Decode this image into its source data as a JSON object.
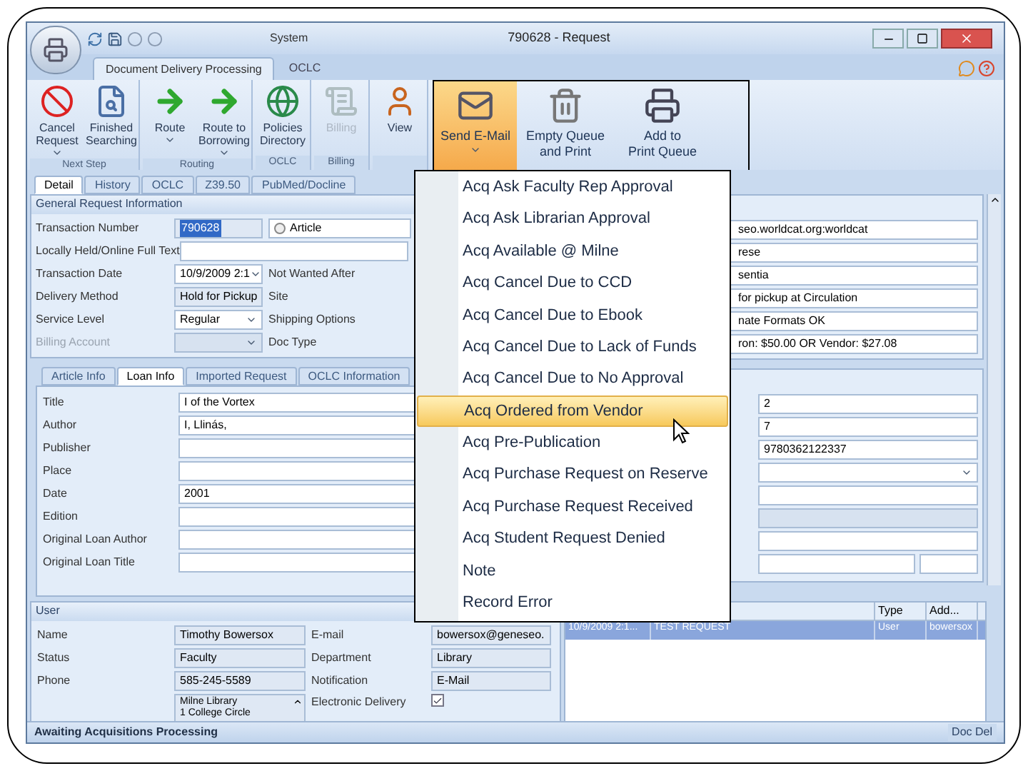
{
  "window": {
    "title": "790628 - Request",
    "context_tab": "System"
  },
  "ribbon_tabs": [
    {
      "label": "Document Delivery Processing",
      "selected": true
    },
    {
      "label": "OCLC",
      "selected": false
    }
  ],
  "ribbon_groups": [
    {
      "label": "Next Step",
      "buttons": [
        {
          "label": "Cancel\nRequest",
          "dropdown": true,
          "disabled": false
        },
        {
          "label": "Finished\nSearching",
          "dropdown": false,
          "disabled": false
        }
      ]
    },
    {
      "label": "Routing",
      "buttons": [
        {
          "label": "Route\n",
          "dropdown": true,
          "disabled": false
        },
        {
          "label": "Route to\nBorrowing",
          "dropdown": true,
          "disabled": false
        }
      ]
    },
    {
      "label": "OCLC",
      "buttons": [
        {
          "label": "Policies\nDirectory",
          "dropdown": false,
          "disabled": false
        }
      ]
    },
    {
      "label": "Billing",
      "buttons": [
        {
          "label": "Billing",
          "dropdown": false,
          "disabled": true
        }
      ]
    },
    {
      "buttons": [
        {
          "label": "View",
          "dropdown": false,
          "disabled": false
        }
      ]
    }
  ],
  "email_buttons": [
    {
      "label": "Send E-Mail",
      "dropdown": true,
      "selected": true
    },
    {
      "label": "Empty Queue\nand Print",
      "dropdown": false,
      "selected": false
    },
    {
      "label": "Add to\nPrint Queue",
      "dropdown": false,
      "selected": false
    }
  ],
  "email_menu": [
    {
      "label": "Acq Ask Faculty Rep Approval",
      "selected": false
    },
    {
      "label": "Acq Ask Librarian Approval",
      "selected": false
    },
    {
      "label": "Acq Available @ Milne",
      "selected": false
    },
    {
      "label": "Acq Cancel Due to CCD",
      "selected": false
    },
    {
      "label": "Acq Cancel Due to Ebook",
      "selected": false
    },
    {
      "label": "Acq Cancel Due to Lack of Funds",
      "selected": false
    },
    {
      "label": "Acq Cancel Due to No Approval",
      "selected": false
    },
    {
      "label": "Acq Ordered from Vendor",
      "selected": true
    },
    {
      "label": "Acq Pre-Publication",
      "selected": false
    },
    {
      "label": "Acq Purchase Request on Reserve",
      "selected": false
    },
    {
      "label": "Acq Purchase Request Received",
      "selected": false
    },
    {
      "label": "Acq Student Request Denied",
      "selected": false
    },
    {
      "label": "Note",
      "selected": false
    },
    {
      "label": "Record Error",
      "selected": false
    }
  ],
  "detail_tabs": [
    {
      "label": "Detail",
      "selected": true
    },
    {
      "label": "History",
      "selected": false
    },
    {
      "label": "OCLC",
      "selected": false
    },
    {
      "label": "Z39.50",
      "selected": false
    },
    {
      "label": "PubMed/Docline",
      "selected": false
    }
  ],
  "general": {
    "title": "General Request Information",
    "rows": [
      {
        "label": "Transaction Number",
        "value": "790628",
        "kind": "text",
        "text_selected": true,
        "disabled": false,
        "extra": {
          "kind": "radio",
          "label": "Article",
          "checked": false
        }
      },
      {
        "label": "Locally Held/Online Full Text",
        "kind": "wide",
        "disabled": false
      },
      {
        "label": "Transaction Date",
        "value": "10/9/2009 2:1",
        "kind": "combo",
        "disabled": false,
        "extra": {
          "kind": "label",
          "label": "Not Wanted After"
        }
      },
      {
        "label": "Delivery Method",
        "value": "Hold for Pickup",
        "kind": "text",
        "disabled": false,
        "extra": {
          "kind": "label",
          "label": "Site"
        }
      },
      {
        "label": "Service Level",
        "value": "Regular",
        "kind": "combo",
        "disabled": false,
        "extra": {
          "kind": "label",
          "label": "Shipping Options"
        }
      },
      {
        "label": "Billing Account",
        "kind": "combo",
        "disabled": true,
        "extra": {
          "kind": "label",
          "label": "Doc Type"
        }
      }
    ],
    "right_values": [
      "seo.worldcat.org:worldcat",
      "rese",
      "sentia",
      "for pickup at Circulation",
      "nate Formats OK",
      "ron: $50.00 OR Vendor: $27.08"
    ]
  },
  "loan_tabs": [
    {
      "label": "Article Info",
      "selected": false
    },
    {
      "label": "Loan Info",
      "selected": true
    },
    {
      "label": "Imported Request",
      "selected": false
    },
    {
      "label": "OCLC Information",
      "selected": false
    }
  ],
  "loan_fields": [
    {
      "label": "Title",
      "value": "I of the Vortex"
    },
    {
      "label": "Author",
      "value": "I, Llinás,"
    },
    {
      "label": "Publisher"
    },
    {
      "label": "Place"
    },
    {
      "label": "Date",
      "value": "2001"
    },
    {
      "label": "Edition"
    },
    {
      "label": "Original Loan Author"
    },
    {
      "label": "Original Loan Title"
    }
  ],
  "loan_right_fields": [
    {
      "kind": "text",
      "value": "2"
    },
    {
      "kind": "text",
      "value": "7"
    },
    {
      "kind": "text",
      "value": "9780362122337"
    },
    {
      "kind": "combo"
    },
    {
      "kind": "text"
    },
    {
      "kind": "disabled"
    },
    {
      "kind": "text"
    },
    {
      "kind": "split"
    }
  ],
  "user": {
    "title": "User",
    "rows": [
      {
        "label": "Name",
        "value": "Timothy Bowersox",
        "label2": "E-mail",
        "value2": "bowersox@geneseo."
      },
      {
        "label": "Status",
        "value": "Faculty",
        "label2": "Department",
        "value2": "Library"
      },
      {
        "label": "Phone",
        "value": "585-245-5589",
        "label2": "Notification",
        "value2": "E-Mail"
      }
    ],
    "address": [
      "Milne Library",
      "1 College Circle"
    ],
    "electronic_delivery": {
      "label": "Electronic Delivery",
      "checked": true
    }
  },
  "notes": {
    "columns": [
      "",
      "",
      "Type",
      "Add..."
    ],
    "rows": [
      {
        "cells": [
          "10/9/2009 2:1...",
          "TEST REQUEST",
          "User",
          "bowersox"
        ],
        "selected": true
      }
    ]
  },
  "status_bar": {
    "text": "Awaiting Acquisitions Processing",
    "right": "Doc Del"
  }
}
